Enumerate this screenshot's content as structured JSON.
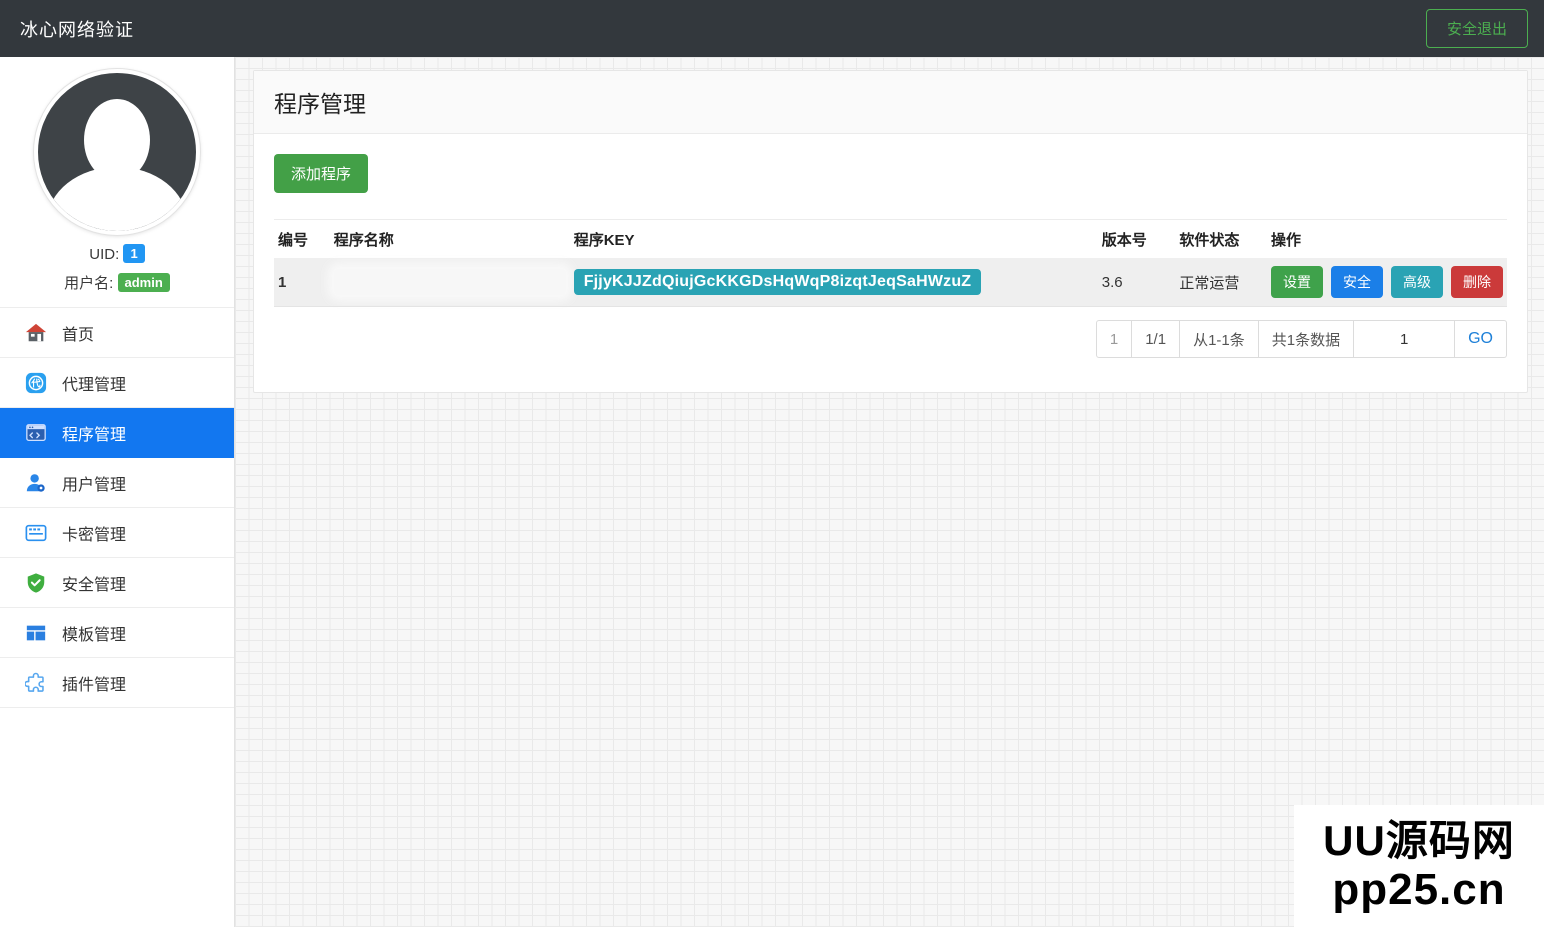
{
  "header": {
    "title": "冰心网络验证",
    "logout_label": "安全退出"
  },
  "sidebar": {
    "uid_label": "UID:",
    "uid_value": "1",
    "username_label": "用户名:",
    "username_value": "admin",
    "items": [
      {
        "label": "首页",
        "icon": "home-icon",
        "active": false
      },
      {
        "label": "代理管理",
        "icon": "agent-icon",
        "active": false
      },
      {
        "label": "程序管理",
        "icon": "program-icon",
        "active": true
      },
      {
        "label": "用户管理",
        "icon": "user-icon",
        "active": false
      },
      {
        "label": "卡密管理",
        "icon": "card-key-icon",
        "active": false
      },
      {
        "label": "安全管理",
        "icon": "shield-icon",
        "active": false
      },
      {
        "label": "模板管理",
        "icon": "template-icon",
        "active": false
      },
      {
        "label": "插件管理",
        "icon": "plugin-icon",
        "active": false
      }
    ]
  },
  "main": {
    "page_title": "程序管理",
    "add_button_label": "添加程序",
    "table": {
      "headers": [
        "编号",
        "程序名称",
        "程序KEY",
        "版本号",
        "软件状态",
        "操作"
      ],
      "rows": [
        {
          "id": "1",
          "name": "",
          "name_redacted": true,
          "key": "FjjyKJJZdQiujGcKKGDsHqWqP8izqtJeqSaHWzuZ",
          "version": "3.6",
          "status": "正常运营",
          "actions": [
            {
              "label": "设置",
              "color": "#3fa24b"
            },
            {
              "label": "安全",
              "color": "#1b7fe8"
            },
            {
              "label": "高级",
              "color": "#2aa3b4"
            },
            {
              "label": "删除",
              "color": "#cb3a3a"
            }
          ]
        }
      ]
    },
    "pagination": {
      "page": "1",
      "page_of": "1/1",
      "range": "从1-1条",
      "total": "共1条数据",
      "input_value": "1",
      "go_label": "GO"
    }
  },
  "watermark": {
    "line1": "UU源码网",
    "line2": "pp25.cn"
  },
  "colors": {
    "topbar_bg": "#33383d",
    "logout_green": "#4caf50",
    "active_item_blue": "#1277f0",
    "uid_badge_blue": "#2196f3",
    "admin_badge_green": "#4caf50",
    "add_button_green": "#43a047",
    "key_badge_teal": "#2aa3b4",
    "delete_red": "#cb3a3a",
    "go_link_blue": "#1e80d8"
  }
}
